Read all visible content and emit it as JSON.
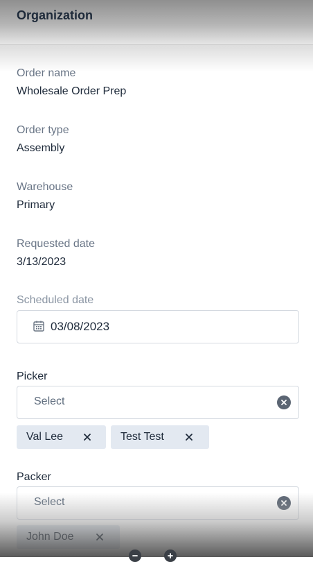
{
  "header": {
    "title": "Organization"
  },
  "fields": {
    "order_name": {
      "label": "Order name",
      "value": "Wholesale Order Prep"
    },
    "order_type": {
      "label": "Order type",
      "value": "Assembly"
    },
    "warehouse": {
      "label": "Warehouse",
      "value": "Primary"
    },
    "requested_date": {
      "label": "Requested date",
      "value": "3/13/2023"
    },
    "scheduled_date": {
      "label": "Scheduled date",
      "value": "03/08/2023"
    }
  },
  "picker": {
    "label": "Picker",
    "placeholder": "Select",
    "chips": [
      "Val Lee",
      "Test Test"
    ]
  },
  "packer": {
    "label": "Packer",
    "placeholder": "Select",
    "chips": [
      "John Doe"
    ]
  },
  "icons": {
    "calendar": "calendar-icon",
    "clear": "clear-circle-icon",
    "remove": "close-icon",
    "zoom_out": "zoom-out-icon",
    "zoom_in": "zoom-in-icon"
  },
  "colors": {
    "text": "#1e2a3a",
    "label": "#697586",
    "chip_bg": "#e3e9f1",
    "border": "#d4d9e0"
  }
}
